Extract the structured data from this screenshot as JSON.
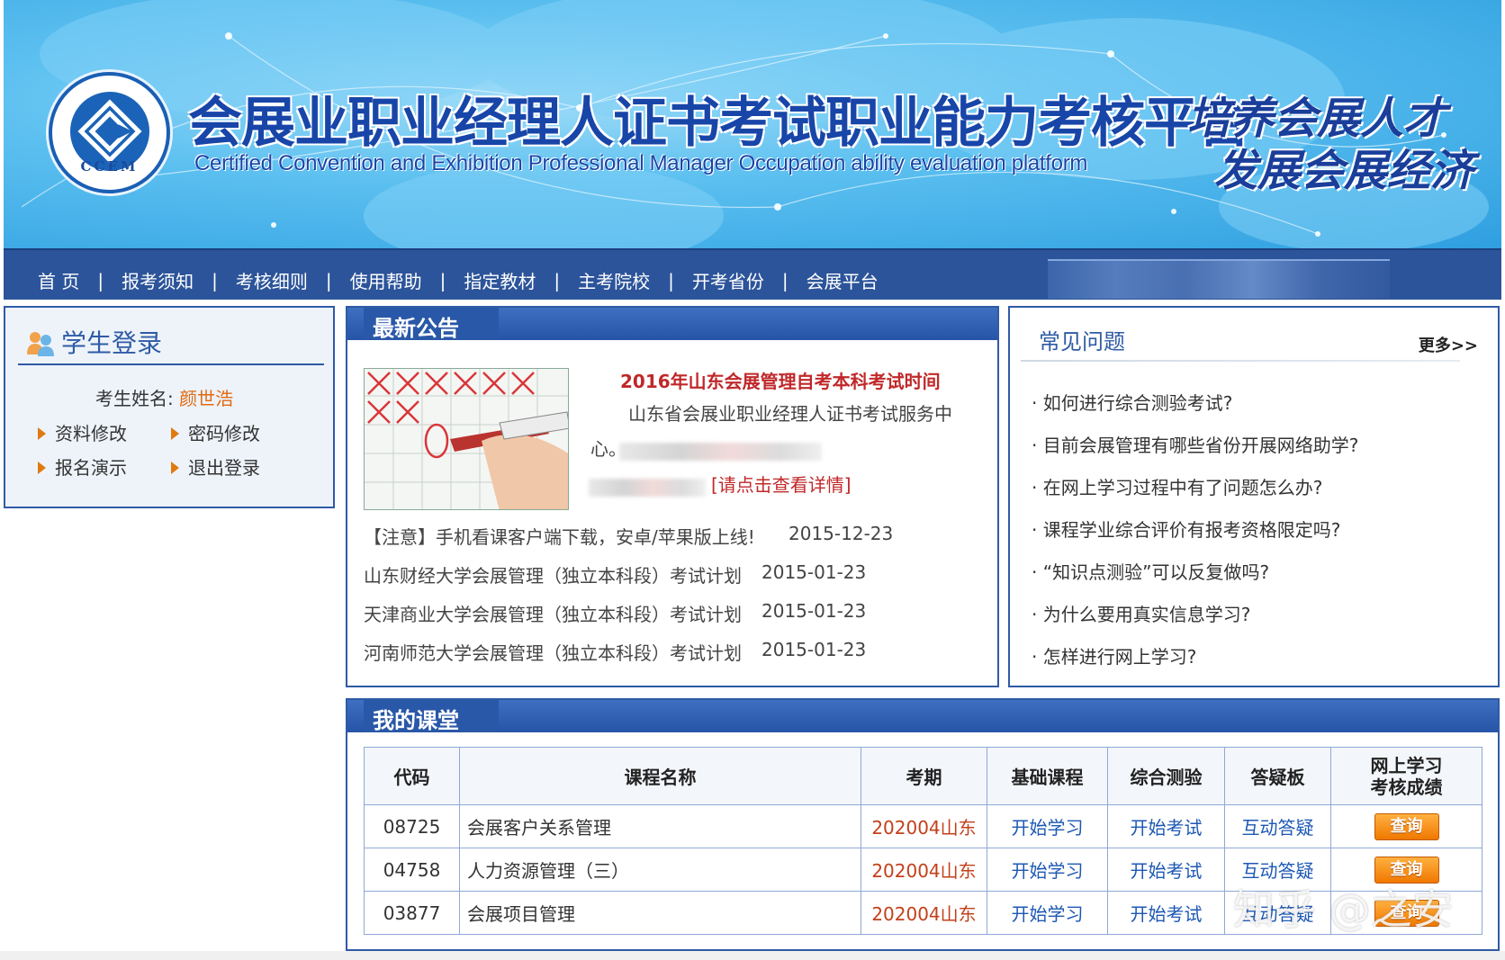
{
  "banner": {
    "title_cn": "会展业职业经理人证书考试职业能力考核平台",
    "title_en": "Certified Convention and Exhibition Professional Manager Occupation ability evaluation platform",
    "logo_text": "CCEM",
    "slogan_line1": "培养会展人才",
    "slogan_line2": "发展会展经济",
    "colors": {
      "title": "#1845a8",
      "banner_bg": "#5cc0f0"
    }
  },
  "nav": {
    "items": [
      "首 页",
      "报考须知",
      "考核细则",
      "使用帮助",
      "指定教材",
      "主考院校",
      "开考省份",
      "会展平台"
    ],
    "separator": "|"
  },
  "login": {
    "title": "学生登录",
    "student_label": "考生姓名:",
    "student_name": "颜世浩",
    "links": [
      "资料修改",
      "密码修改",
      "报名演示",
      "退出登录"
    ]
  },
  "notice": {
    "title": "最新公告",
    "headline": "2016年山东会展管理自考本科考试时间",
    "body_line1": "山东省会展业职业经理人证书考试服务中",
    "body_line2": "心。",
    "more_link": "[请点击查看详情]",
    "rows": [
      {
        "text": "【注意】手机看课客户端下载，安卓/苹果版上线!",
        "date": "2015-12-23"
      },
      {
        "text": "山东财经大学会展管理（独立本科段）考试计划",
        "date": "2015-01-23"
      },
      {
        "text": "天津商业大学会展管理（独立本科段）考试计划",
        "date": "2015-01-23"
      },
      {
        "text": "河南师范大学会展管理（独立本科段）考试计划",
        "date": "2015-01-23"
      }
    ]
  },
  "faq": {
    "title": "常见问题",
    "more": "更多>>",
    "items": [
      "如何进行综合测验考试?",
      "目前会展管理有哪些省份开展网络助学?",
      "在网上学习过程中有了问题怎么办?",
      "课程学业综合评价有报考资格限定吗?",
      "“知识点测验”可以反复做吗?",
      "为什么要用真实信息学习?",
      "怎样进行网上学习?"
    ]
  },
  "courses": {
    "title": "我的课堂",
    "headers": [
      "代码",
      "课程名称",
      "考期",
      "基础课程",
      "综合测验",
      "答疑板",
      "网上学习",
      "考核成绩"
    ],
    "rows": [
      {
        "code": "08725",
        "name": "会展客户关系管理",
        "term": "202004山东",
        "study": "开始学习",
        "exam": "开始考试",
        "qa": "互动答疑",
        "query": "查询"
      },
      {
        "code": "04758",
        "name": "人力资源管理（三）",
        "term": "202004山东",
        "study": "开始学习",
        "exam": "开始考试",
        "qa": "互动答疑",
        "query": "查询"
      },
      {
        "code": "03877",
        "name": "会展项目管理",
        "term": "202004山东",
        "study": "开始学习",
        "exam": "开始考试",
        "qa": "互动答疑",
        "query": "查询"
      }
    ]
  },
  "watermark": "知乎 @之安"
}
